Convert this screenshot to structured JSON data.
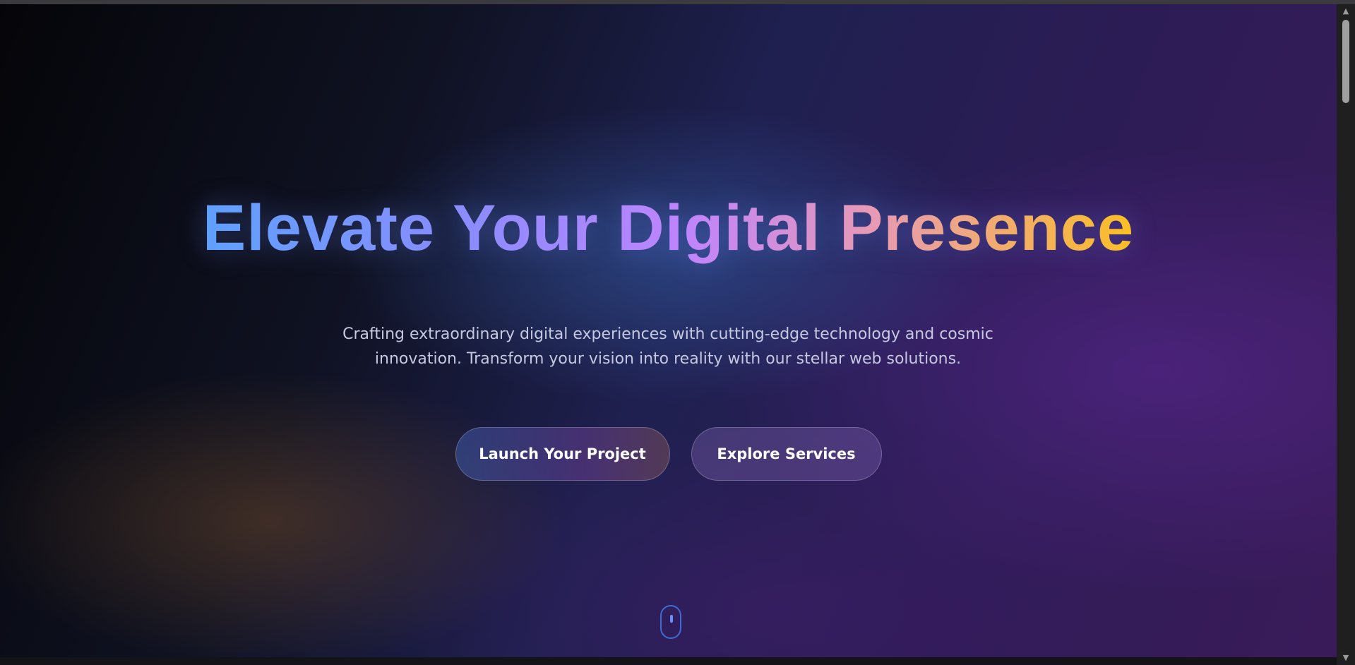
{
  "hero": {
    "title": "Elevate Your Digital Presence",
    "subtitle_line1": "Crafting extraordinary digital experiences with cutting-edge technology and cosmic",
    "subtitle_line2": "innovation. Transform your vision into reality with our stellar web solutions."
  },
  "buttons": {
    "primary_label": "Launch Your Project",
    "secondary_label": "Explore Services"
  },
  "icons": {
    "scroll_indicator": "mouse-scroll-icon",
    "scroll_up": "chevron-up-icon",
    "scroll_down": "chevron-down-icon"
  },
  "colors": {
    "title_gradient": [
      "#5fa0ff",
      "#8a8cff",
      "#c084fc",
      "#e79ab4",
      "#fbbf24"
    ],
    "scroll_indicator": "#3d6bd4",
    "subtitle": "#c6c8e0"
  }
}
